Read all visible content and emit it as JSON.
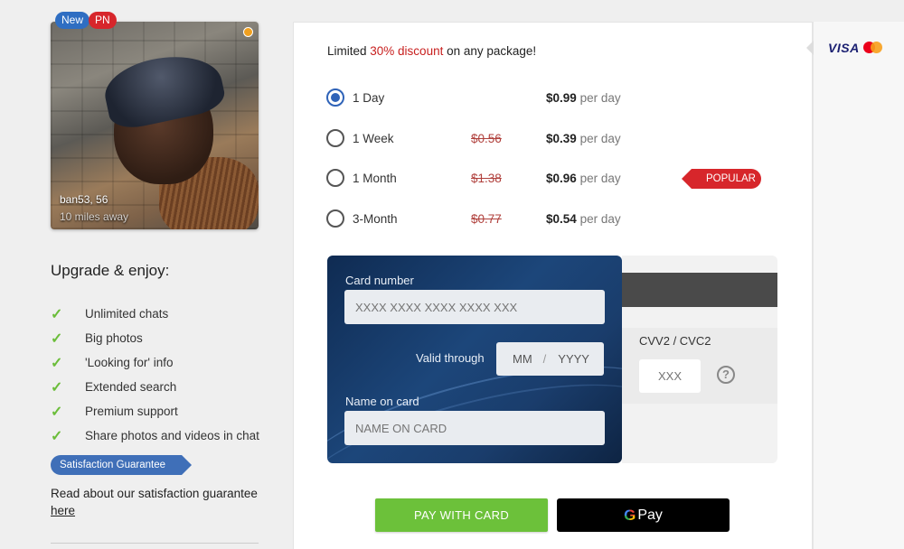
{
  "profile": {
    "badges": [
      "New",
      "PN"
    ],
    "name": "ban53, 56",
    "distance": "10 miles away"
  },
  "upgrade": {
    "title": "Upgrade & enjoy:",
    "features": [
      "Unlimited chats",
      "Big photos",
      "'Looking for' info",
      "Extended search",
      "Premium support",
      "Share photos and videos in chat"
    ],
    "guarantee_tag": "Satisfaction Guarantee",
    "guarantee_text": "Read about our satisfaction guarantee",
    "guarantee_link": "here"
  },
  "payment_brands": {
    "visa": "VISA",
    "mastercard_icon": "mastercard-icon"
  },
  "offer": {
    "prefix": "Limited ",
    "highlight": "30% discount",
    "suffix": " on any package!"
  },
  "packages": [
    {
      "name": "1 Day",
      "old_price": "",
      "price": "$0.99",
      "unit": "per day",
      "selected": true
    },
    {
      "name": "1 Week",
      "old_price": "$0.56",
      "price": "$0.39",
      "unit": "per day",
      "selected": false
    },
    {
      "name": "1 Month",
      "old_price": "$1.38",
      "price": "$0.96",
      "unit": "per day",
      "selected": false
    },
    {
      "name": "3-Month",
      "old_price": "$0.77",
      "price": "$0.54",
      "unit": "per day",
      "selected": false
    }
  ],
  "popular_label": "POPULAR",
  "card": {
    "number_label": "Card number",
    "number_placeholder": "XXXX XXXX XXXX XXXX XXX",
    "valid_label": "Valid through",
    "month_placeholder": "MM",
    "separator": "/",
    "year_placeholder": "YYYY",
    "name_label": "Name on card",
    "name_placeholder": "NAME ON CARD",
    "cvv_label": "CVV2 / CVC2",
    "cvv_placeholder": "XXX",
    "help": "?"
  },
  "buttons": {
    "pay_card": "PAY WITH CARD",
    "gpay_g": "G",
    "gpay_text": "Pay"
  },
  "colors": {
    "accent_green": "#6cc13a",
    "discount_red": "#c8201f",
    "selected_blue": "#2f63b8",
    "popular_red": "#d7262b",
    "card_navy": "#1c467a"
  }
}
